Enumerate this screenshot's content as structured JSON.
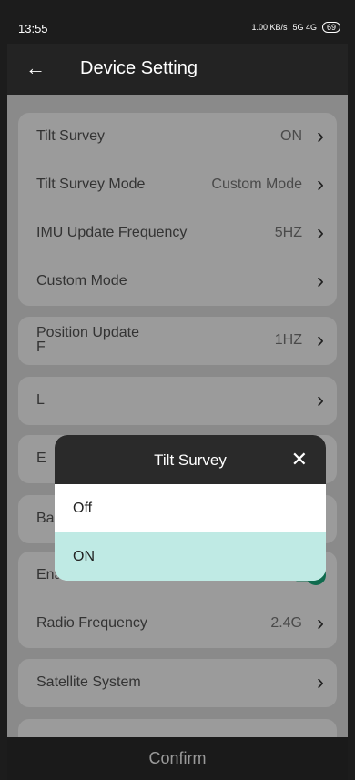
{
  "status": {
    "time": "13:55",
    "net_speed": "1.00 KB/s",
    "signal": "5G 4G",
    "battery": "69"
  },
  "topbar": {
    "back_icon": "arrow-left-icon",
    "title": "Device Setting"
  },
  "settings": {
    "tilt_survey": {
      "label": "Tilt Survey",
      "value": "ON"
    },
    "tilt_mode": {
      "label": "Tilt Survey Mode",
      "value": "Custom Mode"
    },
    "imu_freq": {
      "label": "IMU Update Frequency",
      "value": "5HZ"
    },
    "custom_mode": {
      "label": "Custom Mode"
    },
    "position_update": {
      "label_line1": "Position Update",
      "label_line2": "F",
      "value": "1HZ"
    },
    "partial_L": {
      "label": "L"
    },
    "partial_E": {
      "label": "E"
    },
    "base_move_alarm": {
      "label": "Base Move Alarm"
    },
    "enable_wifi": {
      "label": "Enable WIFI"
    },
    "radio_freq": {
      "label": "Radio Frequency",
      "value": "2.4G"
    },
    "satellite_system": {
      "label": "Satellite System"
    }
  },
  "dialog": {
    "title": "Tilt Survey",
    "options": [
      "Off",
      "ON"
    ],
    "selected": "ON"
  },
  "footer": {
    "confirm_label": "Confirm"
  }
}
